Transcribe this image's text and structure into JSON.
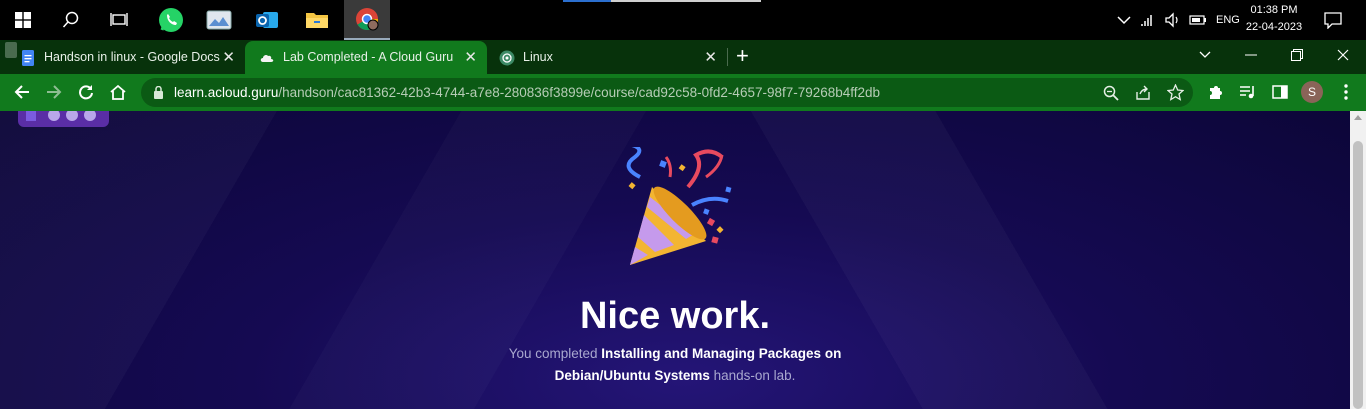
{
  "taskbar": {
    "apps": [
      {
        "name": "start-button",
        "icon": "windows-icon"
      },
      {
        "name": "search-button",
        "icon": "search-icon"
      },
      {
        "name": "task-view-button",
        "icon": "task-view-icon"
      },
      {
        "name": "whatsapp-app",
        "icon": "whatsapp-icon"
      },
      {
        "name": "photos-app",
        "icon": "photos-icon"
      },
      {
        "name": "outlook-app",
        "icon": "outlook-icon"
      },
      {
        "name": "file-explorer-app",
        "icon": "folder-icon"
      },
      {
        "name": "chrome-app",
        "icon": "chrome-icon"
      }
    ],
    "language": "ENG",
    "time": "01:38 PM",
    "date": "22-04-2023"
  },
  "tabs": [
    {
      "title": "Handson in linux - Google Docs",
      "icon": "google-docs-icon",
      "active": false
    },
    {
      "title": "Lab Completed - A Cloud Guru",
      "icon": "cloud-icon",
      "active": true
    },
    {
      "title": "Linux",
      "icon": "chatgpt-icon",
      "active": false
    }
  ],
  "new_tab_symbol": "+",
  "toolbar": {
    "url_host": "learn.acloud.guru",
    "url_path": "/handson/cac81362-42b3-4744-a7e8-280836f3899e/course/cad92c58-0fd2-4657-98f7-79268b4ff2db",
    "profile_initial": "S"
  },
  "page": {
    "heading": "Nice work.",
    "desc_prefix": "You completed ",
    "desc_bold_1": "Installing and Managing Packages on",
    "desc_bold_2": "Debian/Ubuntu Systems",
    "desc_suffix": " hands-on lab."
  },
  "colors": {
    "tab_strip": "#07320b",
    "active_tab": "#117a1d",
    "page_bg": "#150a52"
  }
}
